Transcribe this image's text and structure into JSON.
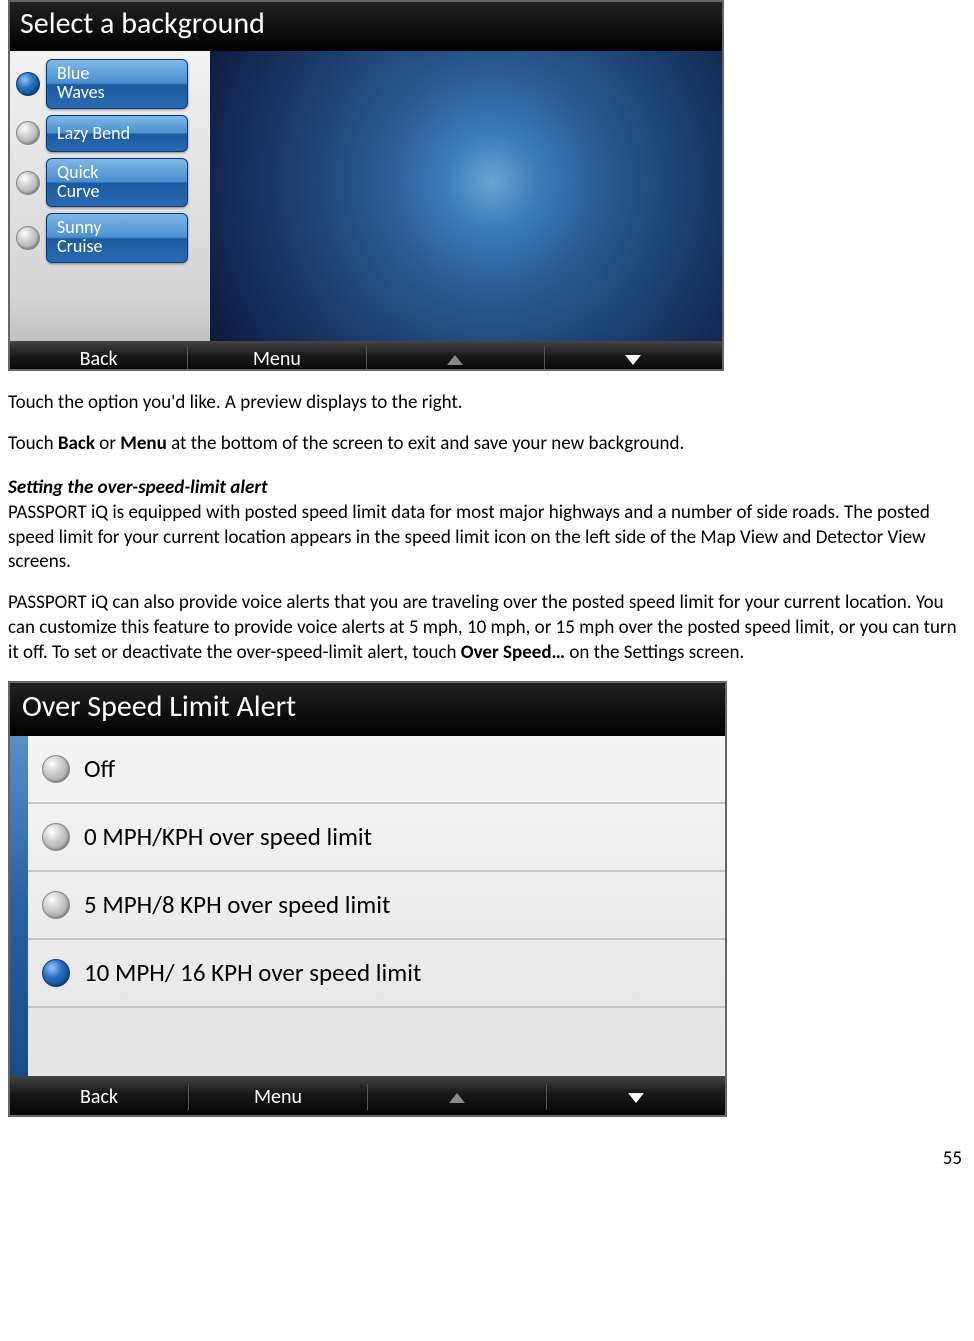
{
  "screenshot1": {
    "title": "Select a background",
    "options": [
      "Blue Waves",
      "Lazy Bend",
      "Quick Curve",
      "Sunny Cruise"
    ],
    "selected": 0,
    "bottom": {
      "back": "Back",
      "menu": "Menu"
    }
  },
  "text": {
    "p1a": "Touch the option you'd like. A preview displays to the right.",
    "p2a": "Touch ",
    "p2b": "Back",
    "p2c": " or ",
    "p2d": "Menu",
    "p2e": " at the bottom of the screen to exit and save your new background.",
    "h1": "Setting the over-speed-limit alert",
    "p3": "PASSPORT iQ is equipped with posted speed limit data for most major highways and a number of side roads. The posted speed limit for your current location appears in the speed limit icon on the left side of the Map View and Detector View screens.",
    "p4a": "PASSPORT iQ can also provide voice alerts that you are traveling over the posted speed limit for your current location. You can customize this feature to provide voice alerts at 5 mph, 10 mph, or 15 mph over the posted speed limit, or you can turn it off. To set or deactivate the over-speed-limit alert, touch ",
    "p4b": "Over Speed…",
    "p4c": " on the Settings screen."
  },
  "screenshot2": {
    "title": "Over Speed Limit Alert",
    "options": [
      "Off",
      "0 MPH/KPH over speed limit",
      "5 MPH/8 KPH over speed limit",
      "10 MPH/ 16 KPH over speed limit"
    ],
    "selected": 3,
    "bottom": {
      "back": "Back",
      "menu": "Menu"
    }
  },
  "page_number": "55"
}
